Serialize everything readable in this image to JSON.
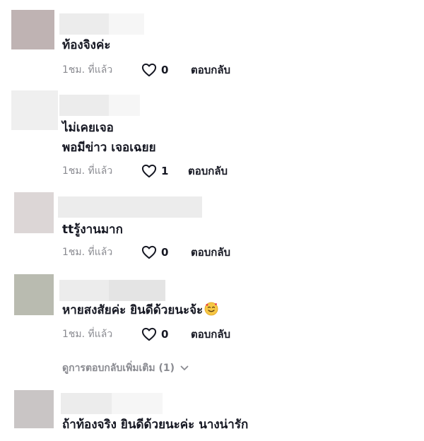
{
  "comments": [
    {
      "lines": [
        "ท้องจิงค่ะ"
      ],
      "time": "1ชม. ที่แล้ว",
      "likes": "0",
      "reply": "ตอบกลับ",
      "avatar_color": "#bfb3b3"
    },
    {
      "lines": [
        "ไม่เคยเจอ",
        "พอมีข่าว เจอเฉยย"
      ],
      "time": "1ชม. ที่แล้ว",
      "likes": "1",
      "reply": "ตอบกลับ",
      "avatar_color": "#efefef"
    },
    {
      "lines": [
        "ttรู้งานมาก"
      ],
      "time": "1ชม. ที่แล้ว",
      "likes": "0",
      "reply": "ตอบกลับ",
      "avatar_color": "#dcd6d6"
    },
    {
      "lines": [
        "หายสงสัยค่ะ ยินดีด้วยนะจ้ะ"
      ],
      "time": "1ชม. ที่แล้ว",
      "likes": "0",
      "reply": "ตอบกลับ",
      "avatar_color": "#b9bbb0",
      "emoji": "smiling-face-with-hearts"
    },
    {
      "lines": [
        "ถ้าท้องจริง ยินดีด้วยนะค่ะ นางน่ารัก"
      ],
      "avatar_color": "#c9c5c5"
    }
  ],
  "view_more": "ดูการตอบกลับเพิ่มเติม (1)",
  "colors": {
    "text": "#161823",
    "muted": "#8a8b91"
  }
}
